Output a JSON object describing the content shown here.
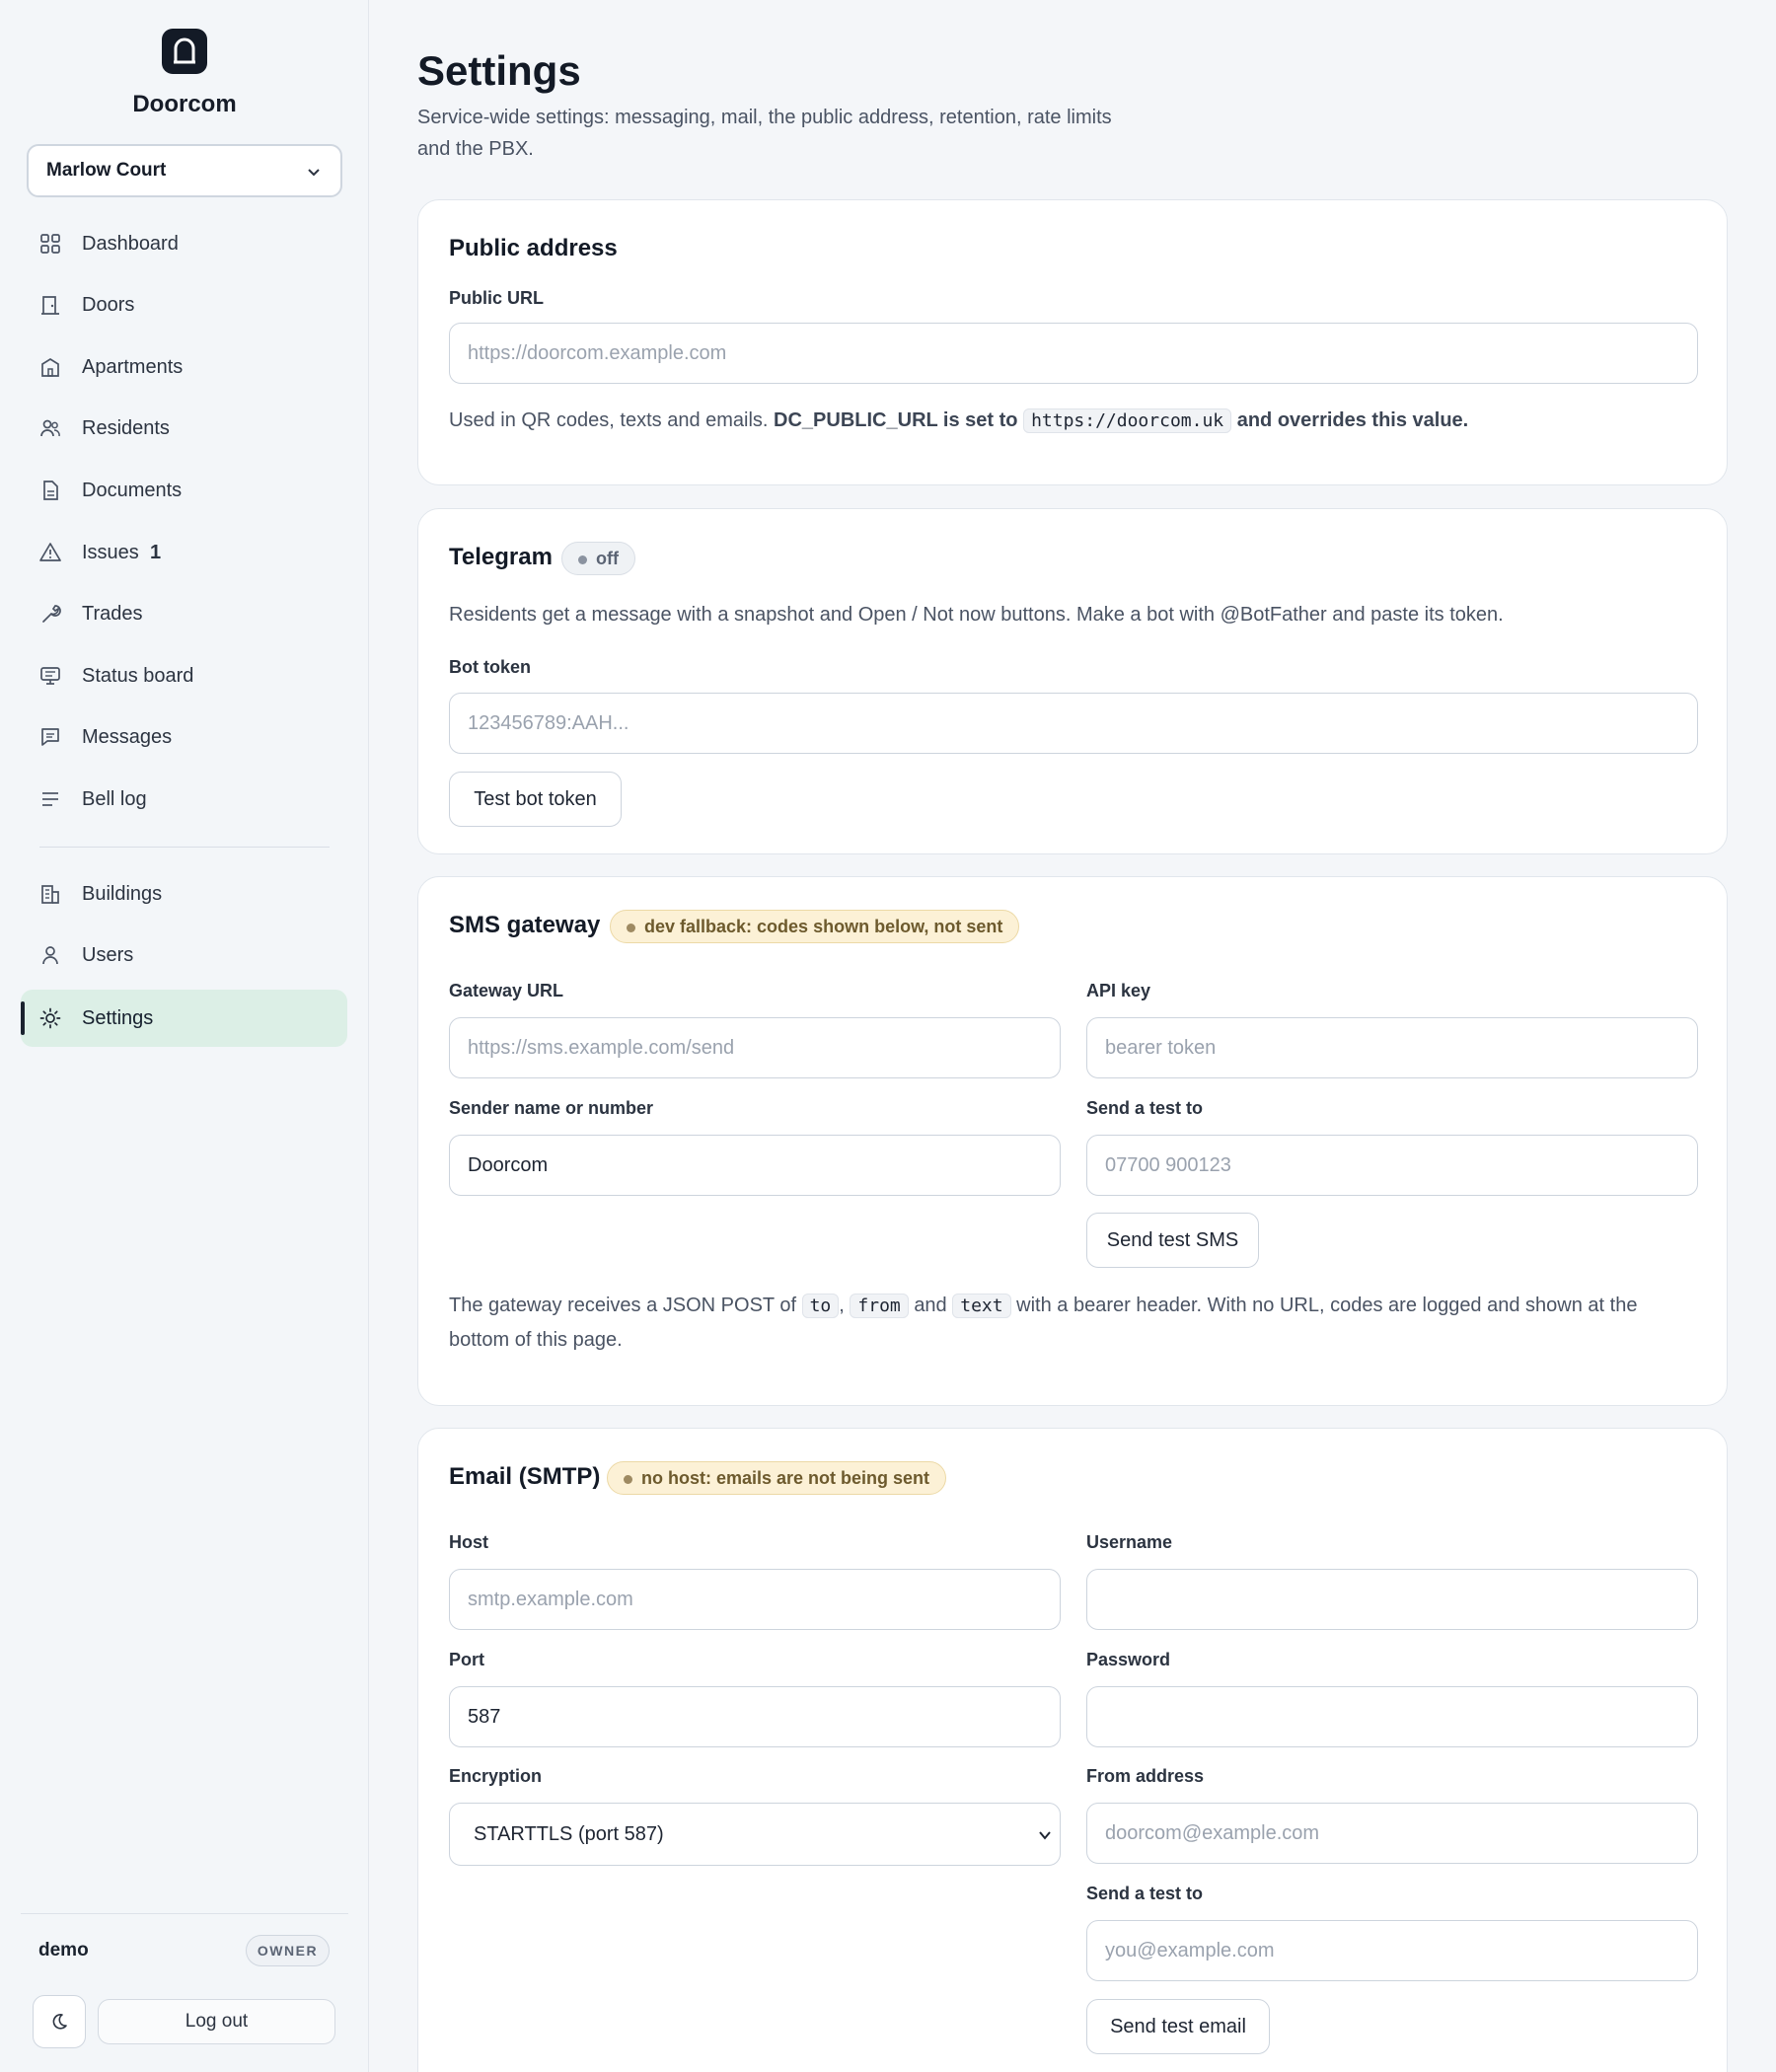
{
  "app": {
    "name": "Doorcom"
  },
  "building_selector": {
    "value": "Marlow Court"
  },
  "nav": {
    "primary": [
      {
        "key": "dashboard",
        "label": "Dashboard",
        "icon": "dashboard-grid-icon"
      },
      {
        "key": "doors",
        "label": "Doors",
        "icon": "door-icon"
      },
      {
        "key": "apartments",
        "label": "Apartments",
        "icon": "apartment-building-icon"
      },
      {
        "key": "residents",
        "label": "Residents",
        "icon": "people-icon"
      },
      {
        "key": "documents",
        "label": "Documents",
        "icon": "document-icon"
      },
      {
        "key": "issues",
        "label": "Issues",
        "icon": "warning-triangle-icon",
        "count": "1"
      },
      {
        "key": "trades",
        "label": "Trades",
        "icon": "wrench-icon"
      },
      {
        "key": "status-board",
        "label": "Status board",
        "icon": "monitor-icon"
      },
      {
        "key": "messages",
        "label": "Messages",
        "icon": "chat-icon"
      },
      {
        "key": "bell-log",
        "label": "Bell log",
        "icon": "list-lines-icon"
      }
    ],
    "secondary": [
      {
        "key": "buildings",
        "label": "Buildings",
        "icon": "buildings-icon"
      },
      {
        "key": "users",
        "label": "Users",
        "icon": "user-icon"
      },
      {
        "key": "settings",
        "label": "Settings",
        "icon": "sun-gear-icon",
        "active": true
      }
    ]
  },
  "user": {
    "name": "demo",
    "role": "OWNER"
  },
  "footer": {
    "logout_label": "Log out"
  },
  "page": {
    "title": "Settings",
    "subtitle": "Service-wide settings: messaging, mail, the public address, retention, rate limits and the PBX."
  },
  "public_address": {
    "title": "Public address",
    "url_label": "Public URL",
    "url_placeholder": "https://doorcom.example.com",
    "help_prefix": "Used in QR codes, texts and emails.",
    "help_env": "DC_PUBLIC_URL is set to",
    "help_value": "https://doorcom.uk",
    "help_suffix": "and overrides this value."
  },
  "telegram": {
    "title": "Telegram",
    "status": "off",
    "description": "Residents get a message with a snapshot and Open / Not now buttons. Make a bot with @BotFather and paste its token.",
    "token_label": "Bot token",
    "token_placeholder": "123456789:AAH...",
    "test_button": "Test bot token"
  },
  "sms": {
    "title": "SMS gateway",
    "status": "dev fallback: codes shown below, not sent",
    "gateway_url_label": "Gateway URL",
    "gateway_url_placeholder": "https://sms.example.com/send",
    "api_key_label": "API key",
    "api_key_placeholder": "bearer token",
    "sender_label": "Sender name or number",
    "sender_value": "Doorcom",
    "test_to_label": "Send a test to",
    "test_to_placeholder": "07700 900123",
    "test_button": "Send test SMS",
    "help_1": "The gateway receives a JSON POST of",
    "code_to": "to",
    "help_comma": ",",
    "code_from": "from",
    "help_and": "and",
    "code_text": "text",
    "help_2": "with a bearer header. With no URL, codes are logged and shown at the bottom of this page."
  },
  "email": {
    "title": "Email (SMTP)",
    "status": "no host: emails are not being sent",
    "host_label": "Host",
    "host_placeholder": "smtp.example.com",
    "username_label": "Username",
    "username_value": "",
    "port_label": "Port",
    "port_value": "587",
    "password_label": "Password",
    "password_value": "",
    "encryption_label": "Encryption",
    "encryption_value": "STARTTLS (port 587)",
    "from_label": "From address",
    "from_placeholder": "doorcom@example.com",
    "test_to_label": "Send a test to",
    "test_to_placeholder": "you@example.com",
    "test_button": "Send test email"
  }
}
